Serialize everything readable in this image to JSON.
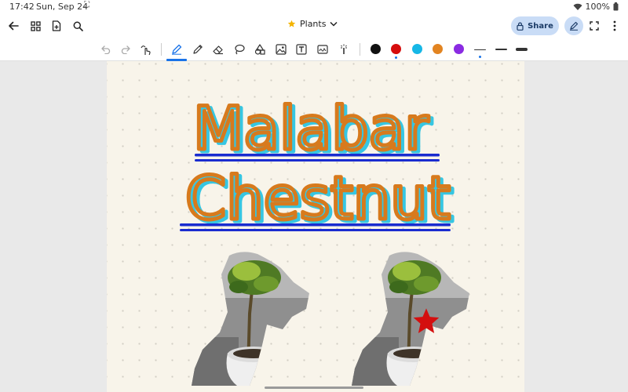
{
  "status_bar": {
    "time": "17:42",
    "date": "Sun, Sep 24",
    "battery": "100%"
  },
  "app_bar": {
    "title": "Plants",
    "share_label": "Share"
  },
  "toolbar": {
    "tools": [
      "undo-icon",
      "redo-icon",
      "touch-draw-icon",
      "pen-icon",
      "pencil-icon",
      "eraser-icon",
      "lasso-icon",
      "shapes-icon",
      "image-icon",
      "text-box-icon",
      "sticker-icon",
      "laser-pointer-icon"
    ],
    "active_tool": "pen-icon",
    "colors": [
      "#111111",
      "#d60d0d",
      "#16b7e6",
      "#e28421",
      "#8a2be2"
    ],
    "selected_color": "#d60d0d",
    "selected_stroke": "thin"
  },
  "canvas": {
    "handwriting": [
      "Malabar",
      "Chestnut"
    ],
    "ink_color": "#d77a1d",
    "highlight_color": "#36c6e2",
    "underline_color": "#1a2ccf",
    "star_color": "#d40f0f"
  }
}
